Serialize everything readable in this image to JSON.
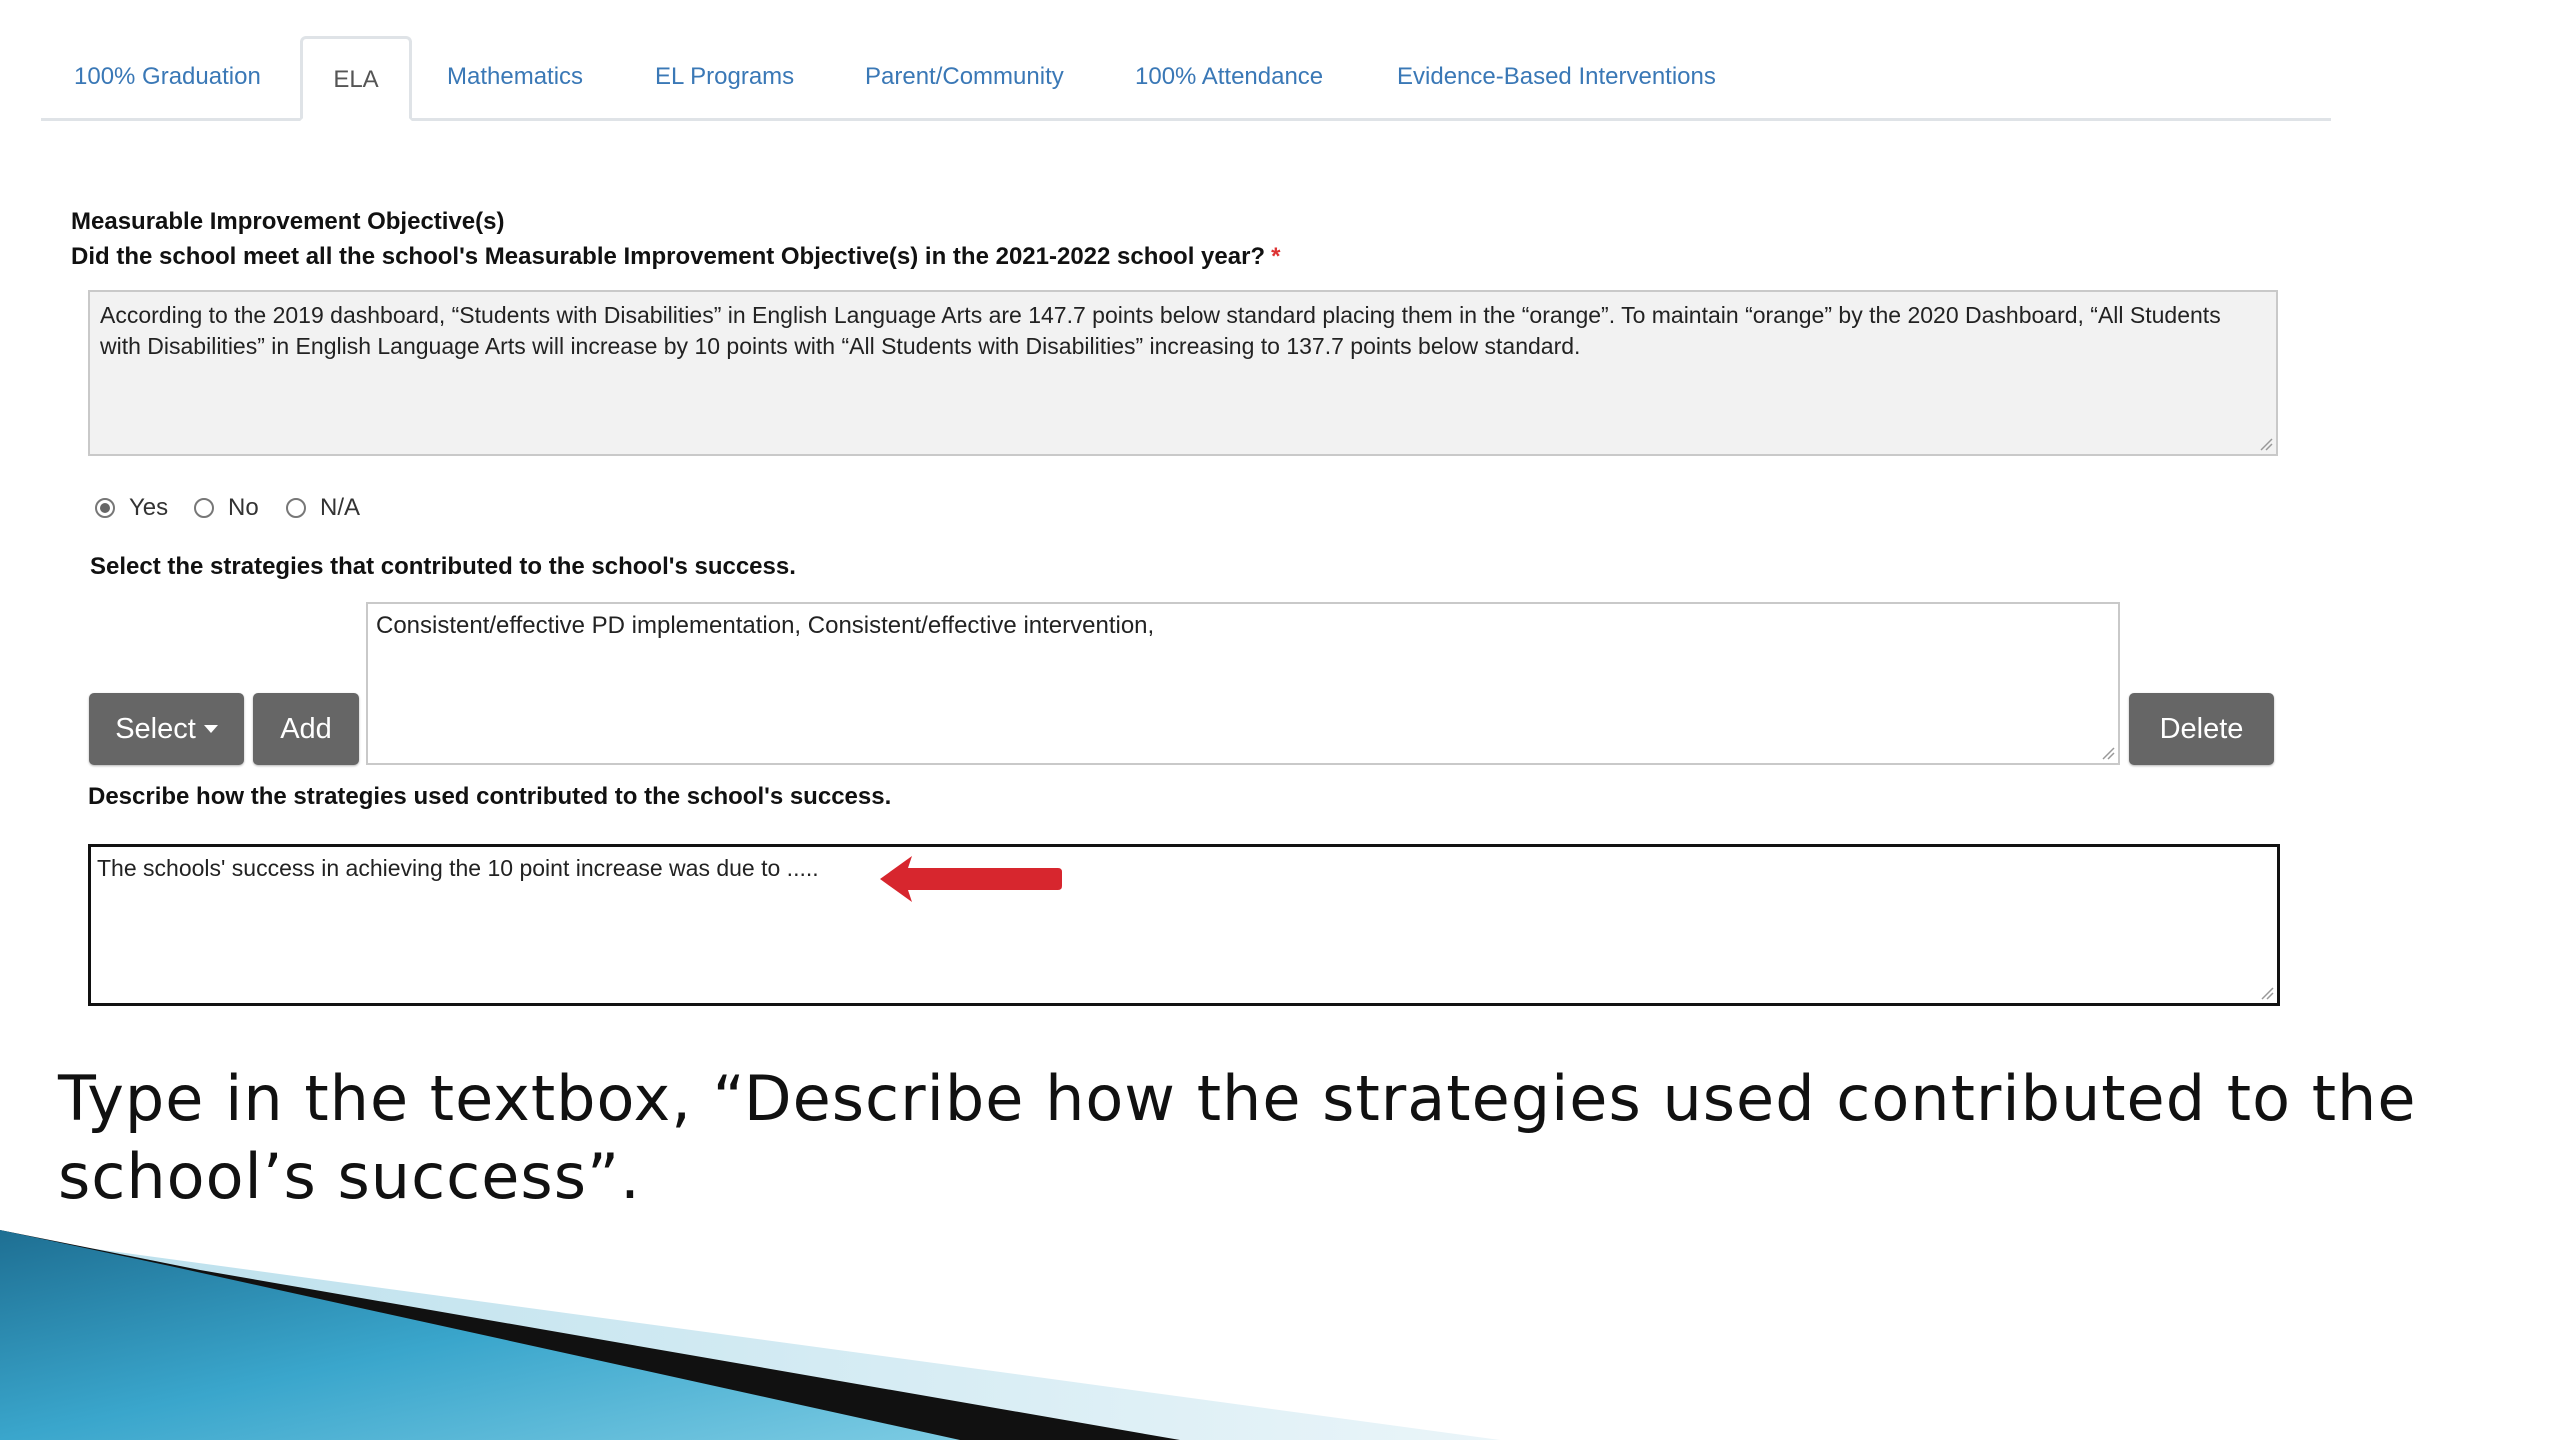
{
  "tabs": [
    {
      "label": "100% Graduation"
    },
    {
      "label": "ELA",
      "active": true
    },
    {
      "label": "Mathematics"
    },
    {
      "label": "EL Programs"
    },
    {
      "label": "Parent/Community"
    },
    {
      "label": "100% Attendance"
    },
    {
      "label": "Evidence-Based Interventions"
    }
  ],
  "objective": {
    "heading": "Measurable  Improvement Objective(s)",
    "question": "Did the school meet all the school's Measurable Improvement Objective(s) in the 2021-2022 school year?",
    "required_mark": "*",
    "text": "According to the 2019 dashboard, “Students with Disabilities”  in English Language Arts are 147.7 points below standard placing them in the “orange”.  To maintain “orange” by the 2020 Dashboard, “All Students with Disabilities” in English Language Arts will increase by 10 points with “All Students with Disabilities” increasing to 137.7 points below standard."
  },
  "met_options": {
    "selected": "Yes",
    "options": [
      "Yes",
      "No",
      "N/A"
    ]
  },
  "strategies": {
    "label": "Select the strategies that contributed to the school's success.",
    "selected_text": "Consistent/effective PD implementation,      Consistent/effective intervention,",
    "select_button": "Select",
    "add_button": "Add",
    "delete_button": "Delete"
  },
  "describe": {
    "label": "Describe how the strategies used contributed to the school's success.",
    "value": "The schools' success in achieving the 10 point increase was due to ....."
  },
  "caption": "Type in the textbox, “Describe how the strategies used contributed to the school’s success”.",
  "colors": {
    "tab_link": "#3a78b6",
    "button_bg": "#666666",
    "arrow": "#d7262e",
    "required": "#dd3333",
    "decor_teal": "#2a8fb5",
    "decor_dark": "#111111"
  },
  "icons": [
    "caret-down-icon",
    "red-arrow-icon",
    "resize-grip-icon"
  ]
}
